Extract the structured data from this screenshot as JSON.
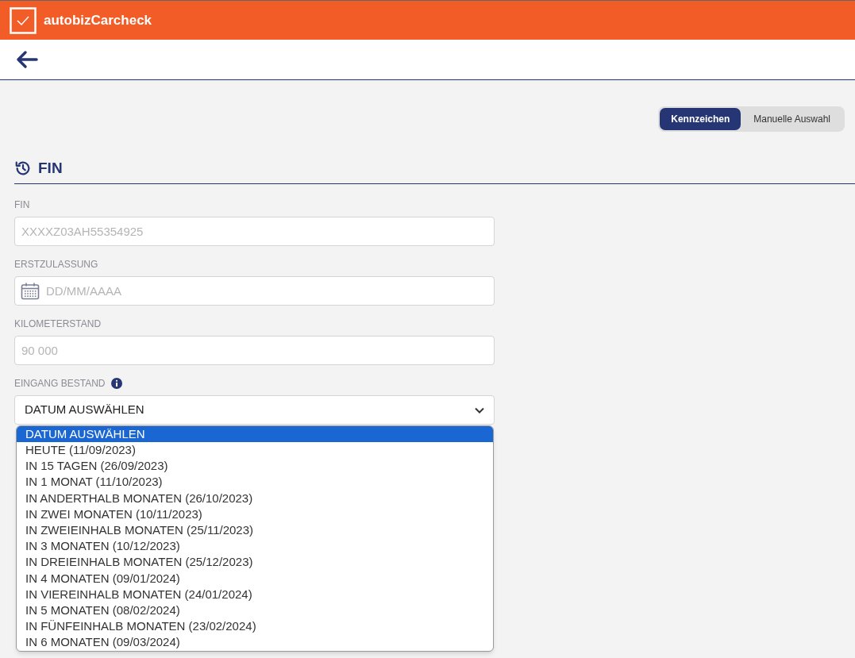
{
  "header": {
    "brand": "autobizCarcheck"
  },
  "mode_toggle": [
    {
      "label": "Kennzeichen",
      "selected": true
    },
    {
      "label": "Manuelle Auswahl",
      "selected": false
    }
  ],
  "section": {
    "title": "FIN"
  },
  "fields": [
    {
      "kind": "text",
      "label": "FIN",
      "placeholder": "XXXXZ03AH55354925"
    },
    {
      "kind": "date",
      "label": "ERSTZULASSUNG",
      "placeholder": "DD/MM/AAAA"
    },
    {
      "kind": "text",
      "label": "KILOMETERSTAND",
      "placeholder": "90 000"
    },
    {
      "kind": "select",
      "label": "EINGANG BESTAND",
      "info": true,
      "value": "DATUM AUSWÄHLEN"
    }
  ],
  "dropdown_options": [
    {
      "label": "DATUM AUSWÄHLEN",
      "selected": true
    },
    {
      "label": "HEUTE (11/09/2023)",
      "selected": false
    },
    {
      "label": "IN 15 TAGEN (26/09/2023)",
      "selected": false
    },
    {
      "label": "IN 1 MONAT (11/10/2023)",
      "selected": false
    },
    {
      "label": "IN ANDERTHALB MONATEN (26/10/2023)",
      "selected": false
    },
    {
      "label": "IN ZWEI MONATEN (10/11/2023)",
      "selected": false
    },
    {
      "label": "IN ZWEIEINHALB MONATEN (25/11/2023)",
      "selected": false
    },
    {
      "label": "IN 3 MONATEN (10/12/2023)",
      "selected": false
    },
    {
      "label": "IN DREIEINHALB MONATEN (25/12/2023)",
      "selected": false
    },
    {
      "label": "IN 4 MONATEN (09/01/2024)",
      "selected": false
    },
    {
      "label": "IN VIEREINHALB MONATEN (24/01/2024)",
      "selected": false
    },
    {
      "label": "IN 5 MONATEN (08/02/2024)",
      "selected": false
    },
    {
      "label": "IN FÜNFEINHALB MONATEN (23/02/2024)",
      "selected": false
    },
    {
      "label": "IN 6 MONATEN (09/03/2024)",
      "selected": false
    }
  ]
}
